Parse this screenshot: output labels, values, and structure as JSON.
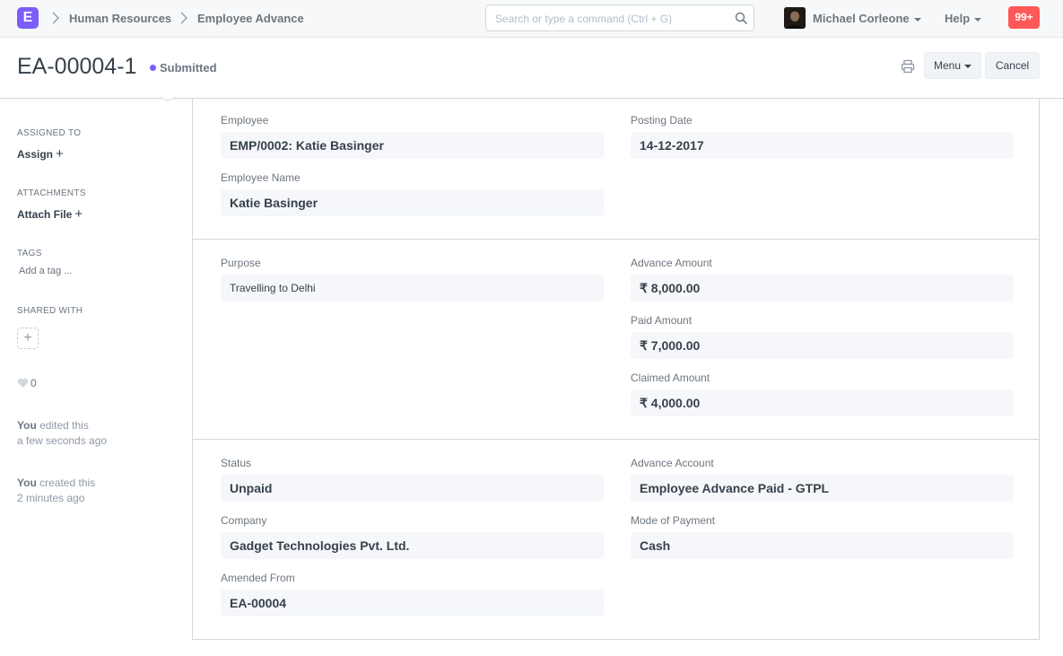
{
  "navbar": {
    "logo_letter": "E",
    "breadcrumbs": [
      "Human Resources",
      "Employee Advance"
    ],
    "search_placeholder": "Search or type a command (Ctrl + G)",
    "user_name": "Michael Corleone",
    "help_label": "Help",
    "notification_count": "99+"
  },
  "page": {
    "title": "EA-00004-1",
    "status": "Submitted",
    "status_color": "#7c5cfa",
    "menu_label": "Menu",
    "cancel_label": "Cancel"
  },
  "sidebar": {
    "assigned_to_label": "ASSIGNED TO",
    "assign_label": "Assign",
    "attachments_label": "ATTACHMENTS",
    "attach_label": "Attach File",
    "tags_label": "TAGS",
    "add_tag_label": "Add a tag ...",
    "shared_with_label": "SHARED WITH",
    "likes": "0",
    "activity": [
      {
        "who": "You",
        "action": "edited this",
        "when": "a few seconds ago"
      },
      {
        "who": "You",
        "action": "created this",
        "when": "2 minutes ago"
      }
    ]
  },
  "form": {
    "employee_label": "Employee",
    "employee": "EMP/0002: Katie Basinger",
    "posting_date_label": "Posting Date",
    "posting_date": "14-12-2017",
    "employee_name_label": "Employee Name",
    "employee_name": "Katie Basinger",
    "purpose_label": "Purpose",
    "purpose": "Travelling to Delhi",
    "advance_amount_label": "Advance Amount",
    "advance_amount": "₹ 8,000.00",
    "paid_amount_label": "Paid Amount",
    "paid_amount": "₹ 7,000.00",
    "claimed_amount_label": "Claimed Amount",
    "claimed_amount": "₹ 4,000.00",
    "status_label": "Status",
    "status": "Unpaid",
    "advance_account_label": "Advance Account",
    "advance_account": "Employee Advance Paid - GTPL",
    "company_label": "Company",
    "company": "Gadget Technologies Pvt. Ltd.",
    "mode_of_payment_label": "Mode of Payment",
    "mode_of_payment": "Cash",
    "amended_from_label": "Amended From",
    "amended_from": "EA-00004"
  }
}
